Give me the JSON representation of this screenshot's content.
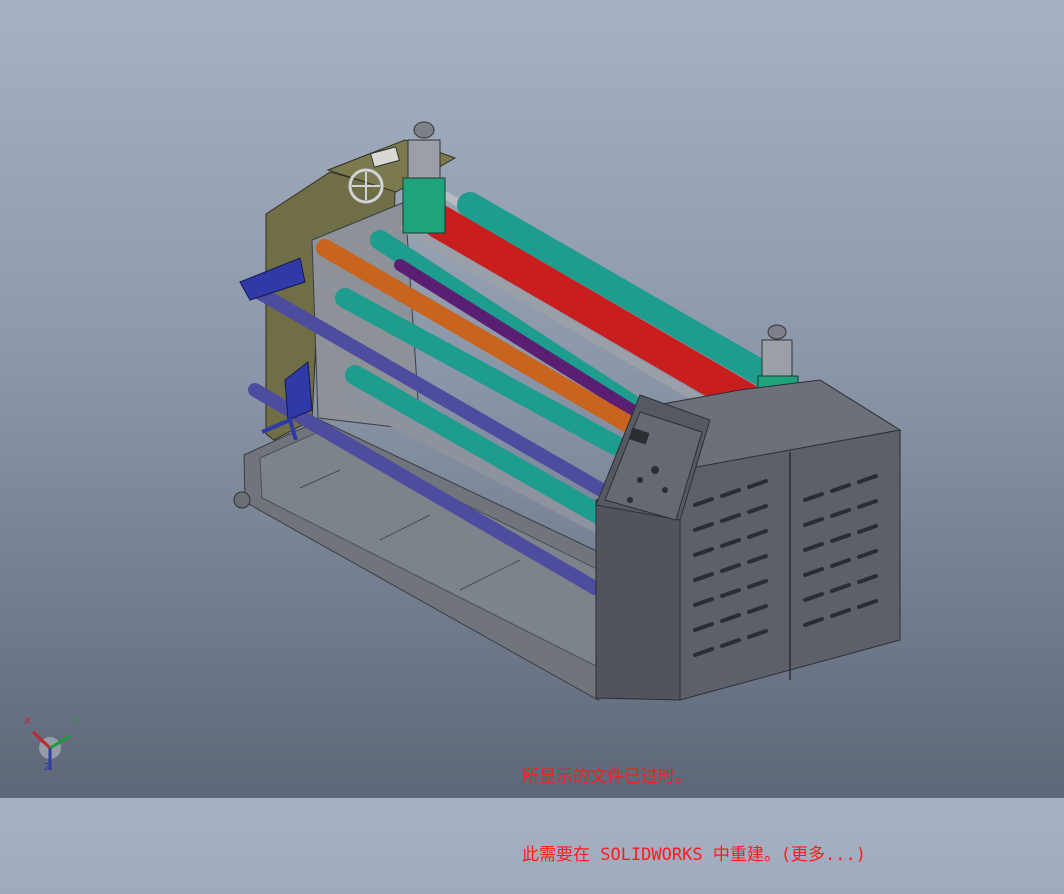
{
  "viewport": {
    "background_top": "#a7b1c3",
    "background_bottom": "#5d6778"
  },
  "model": {
    "roller_colors": {
      "red": "#c81e1e",
      "teal": "#1e9c8e",
      "orange": "#c8641e",
      "purple": "#5a1e73",
      "blue": "#4d4c9e",
      "gray": "#8d939c"
    },
    "frame_color": "#6f6f4a",
    "cabinet_color": "#5c6069"
  },
  "triad": {
    "x_label": "X",
    "y_label": "Y",
    "z_label": "Z"
  },
  "notice": {
    "line1": "所显示的文件已过时。",
    "line2": "此需要在 SOLIDWORKS 中重建。(更多...)"
  }
}
